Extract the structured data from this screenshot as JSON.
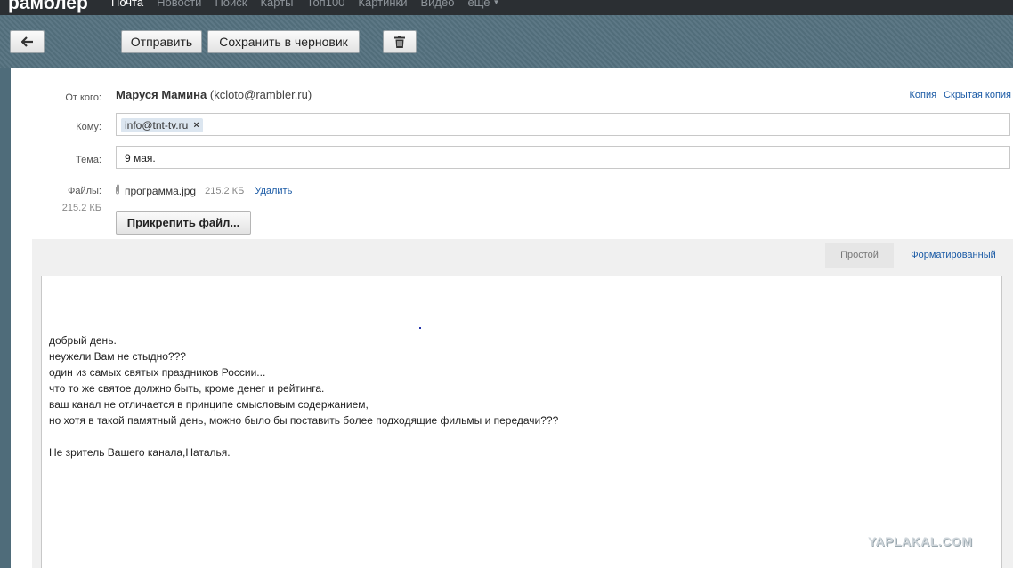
{
  "topnav": {
    "logo": "рамблер",
    "items": [
      {
        "label": "Почта",
        "active": true
      },
      {
        "label": "Новости"
      },
      {
        "label": "Поиск"
      },
      {
        "label": "Карты"
      },
      {
        "label": "Топ100"
      },
      {
        "label": "Картинки"
      },
      {
        "label": "Видео"
      },
      {
        "label": "еще"
      }
    ]
  },
  "toolbar": {
    "back_icon": "←",
    "send_label": "Отправить",
    "draft_label": "Сохранить в черновик",
    "trash_icon": "trash-icon"
  },
  "compose": {
    "from_label": "От кого:",
    "from_name": "Маруся Мамина",
    "from_email": "(kcloto@rambler.ru)",
    "cc_label": "Копия",
    "bcc_label": "Скрытая копия",
    "to_label": "Кому:",
    "to_chip": "info@tnt-tv.ru",
    "to_chip_remove": "×",
    "subject_label": "Тема:",
    "subject_value": "9 мая.",
    "files_label": "Файлы:",
    "files_total": "215.2 КБ",
    "attachment": {
      "name": "программа.jpg",
      "size": "215.2 КБ",
      "delete_label": "Удалить"
    },
    "attach_button": "Прикрепить файл...",
    "tab_plain": "Простой",
    "tab_rich": "Форматированный",
    "body_lines": [
      "добрый день.",
      "неужели Вам не стыдно???",
      "один из самых святых праздников России...",
      "что то же святое должно быть, кроме денег и рейтинга.",
      "ваш канал не отличается в принципе смысловым содержанием,",
      "но хотя в такой памятный день, можно было бы поставить более подходящие фильмы и передачи???",
      "",
      "Не зритель Вашего канала,Наталья."
    ]
  },
  "watermark": "YAPLAKAL.COM"
}
